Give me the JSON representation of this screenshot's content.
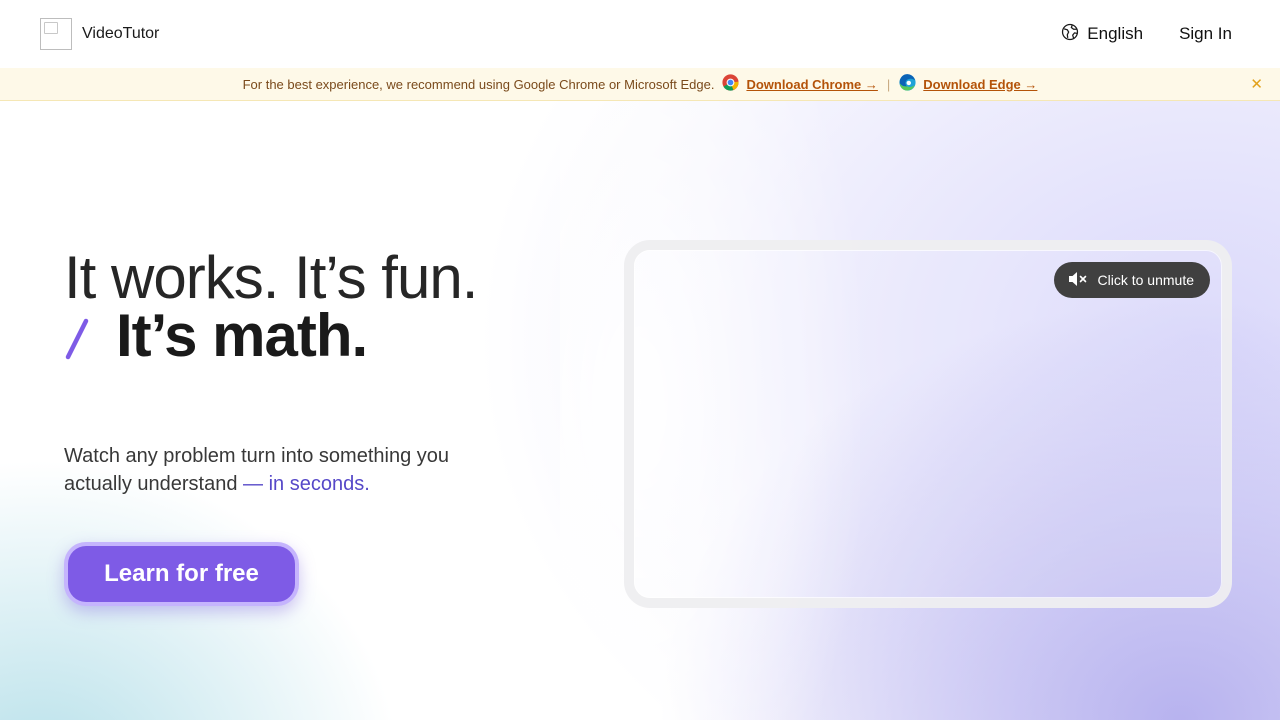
{
  "header": {
    "brand_name": "VideoTutor",
    "language_label": "English",
    "signin_label": "Sign In"
  },
  "banner": {
    "message": "For the best experience, we recommend using Google Chrome or Microsoft Edge.",
    "chrome_link": "Download Chrome →",
    "separator": "|",
    "edge_link": "Download Edge →",
    "close_glyph": "✕"
  },
  "hero": {
    "headline_line1": "It works. It’s fun.",
    "headline_line2": "It’s math.",
    "subtext_main": "Watch any problem turn into something you actually understand",
    "subtext_accent": "— in seconds.",
    "cta_label": "Learn for free"
  },
  "video": {
    "unmute_label": "Click to unmute"
  },
  "icons": {
    "language": "globe-icon",
    "chrome": "chrome-icon",
    "edge": "edge-icon",
    "mute": "speaker-muted-icon",
    "close": "close-icon"
  },
  "colors": {
    "accent_purple": "#7e5be6",
    "accent_text": "#5648c8",
    "banner_bg": "#fef9e8",
    "banner_link": "#b45309"
  }
}
